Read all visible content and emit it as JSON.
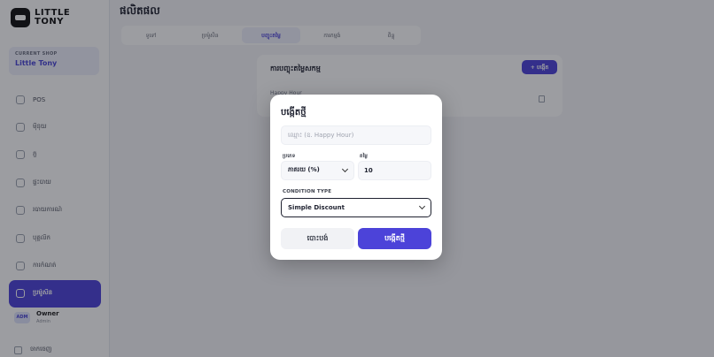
{
  "app": {
    "brand_line1": "LITTLE",
    "brand_line2": "TONY",
    "page_title": "ផលិតផល"
  },
  "sidebar": {
    "shop_label": "CURRENT SHOP",
    "shop_name": "Little Tony",
    "items": [
      {
        "label": "POS",
        "icon": "pos-icon"
      },
      {
        "label": "ម៉ឺនុយ",
        "icon": "menu-icon"
      },
      {
        "label": "ភ្ជ",
        "icon": "table-icon"
      },
      {
        "label": "ផ្ទះបាយ",
        "icon": "kitchen-icon"
      },
      {
        "label": "របាយការណ៍",
        "icon": "report-icon"
      },
      {
        "label": "បុគ្គលិក",
        "icon": "staff-icon"
      },
      {
        "label": "ការកំណត់",
        "icon": "settings-icon"
      },
      {
        "label": "ប្រម៉ូសិន",
        "icon": "promotion-icon",
        "active": true
      }
    ],
    "user": {
      "initials": "ADM",
      "name": "Owner",
      "role": "Admin"
    },
    "logout_label": "ចាកចេញ"
  },
  "tabs": [
    "ទូទៅ",
    "ប្រម៉ូសិន",
    "បញ្ចុះតម្លៃ",
    "ការកម្មង់",
    "ពិន្ទុ"
  ],
  "content": {
    "card_title": "ការបញ្ចុះតម្លៃសកម្ម",
    "add_label": "+ បង្កើត",
    "row_text": "Happy Hour"
  },
  "modal": {
    "title": "បង្កើតថ្មី",
    "name_placeholder": "ឈ្មោះ (ឧ. Happy Hour)",
    "type_label": "ប្រភេទ",
    "type_value": "ភាគរយ (%)",
    "value_label": "តម្លៃ",
    "value_value": "10",
    "condition_label": "CONDITION TYPE",
    "condition_value": "Simple Discount",
    "cancel_label": "បោះបង់",
    "create_label": "បង្កើតថ្មី"
  },
  "colors": {
    "accent": "#4c43d9",
    "overlay": "#14161e"
  }
}
